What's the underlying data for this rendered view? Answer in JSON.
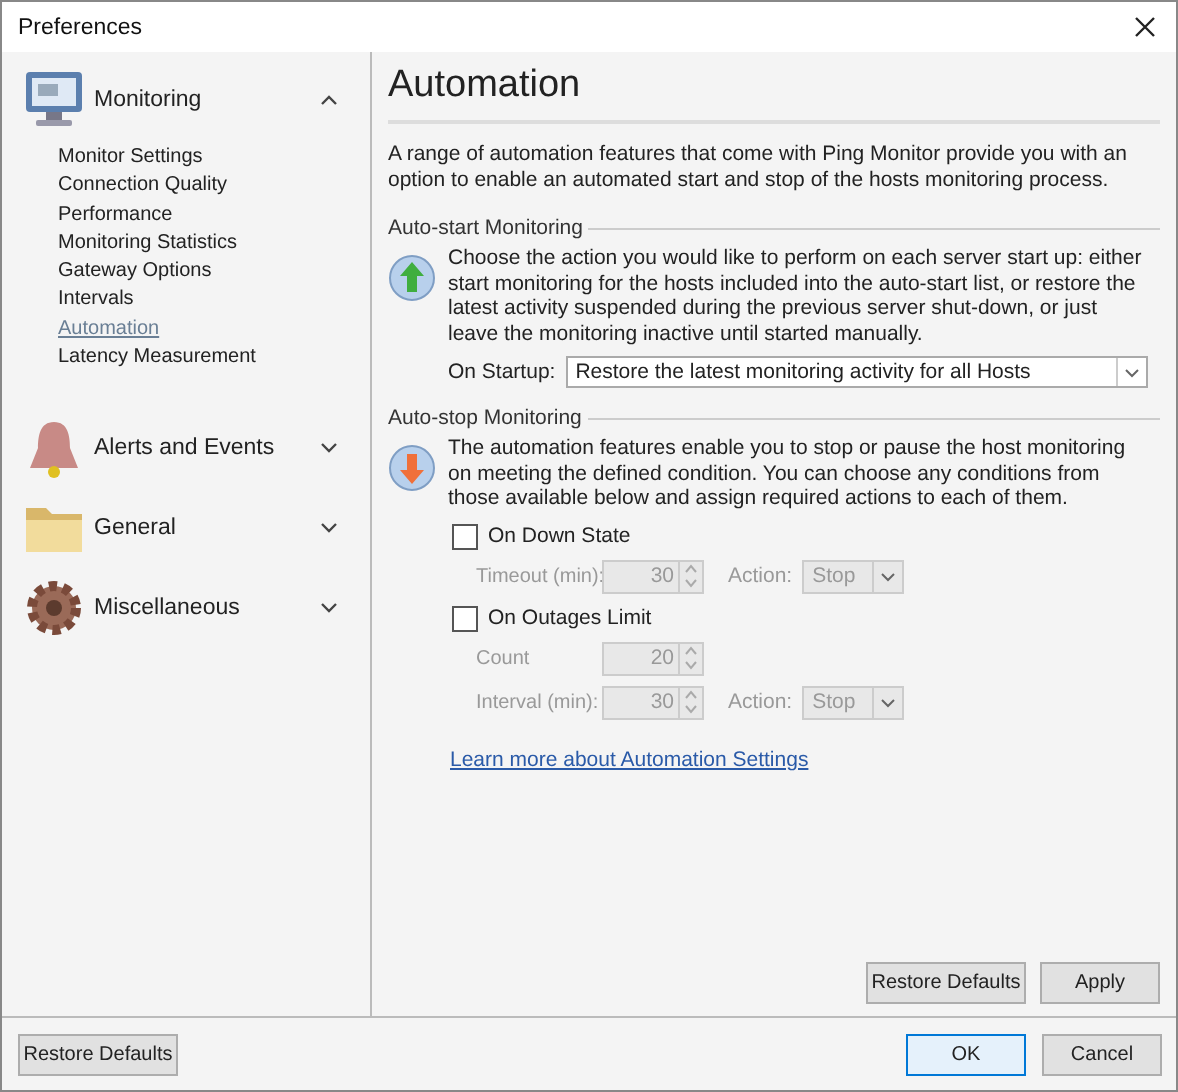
{
  "window": {
    "title": "Preferences"
  },
  "sidebar": {
    "groups": [
      {
        "kind": "monitor",
        "label": "Monitoring",
        "expanded": true,
        "items": [
          {
            "label": "Monitor Settings",
            "selected": false
          },
          {
            "label": "Connection Quality",
            "selected": false
          },
          {
            "label": "Performance",
            "selected": false
          },
          {
            "label": "Monitoring Statistics",
            "selected": false
          },
          {
            "label": "Gateway Options",
            "selected": false
          },
          {
            "label": "Intervals",
            "selected": false
          },
          {
            "label": "Automation",
            "selected": true
          },
          {
            "label": "Latency Measurement",
            "selected": false
          }
        ]
      },
      {
        "kind": "bell",
        "label": "Alerts and Events",
        "expanded": false
      },
      {
        "kind": "folder",
        "label": "General",
        "expanded": false
      },
      {
        "kind": "gear",
        "label": "Miscellaneous",
        "expanded": false
      }
    ]
  },
  "page": {
    "title": "Automation",
    "intro": "A range of automation features that come with Ping Monitor provide you with an option to enable an automated start and stop of the hosts monitoring process.",
    "sections": [
      {
        "kind": "start",
        "heading": "Auto-start Monitoring",
        "description": "Choose the action you would like to perform on each server start up: either start monitoring for the hosts included into the auto-start list, or restore the latest activity suspended during the previous server shut-down, or just leave the monitoring inactive until started manually.",
        "select": {
          "label": "On Startup:",
          "value": "Restore the latest monitoring activity for all Hosts"
        }
      },
      {
        "kind": "stop",
        "heading": "Auto-stop Monitoring",
        "description": "The automation features enable you to stop or pause the host monitoring on meeting the defined condition. You can choose any conditions from those available below and assign required actions to each of them.",
        "options": [
          {
            "label": "On Down State",
            "checked": false,
            "rows": [
              {
                "label": "Timeout (min):",
                "value": "30",
                "disabled": true,
                "action_label": "Action:",
                "action_value": "Stop"
              }
            ]
          },
          {
            "label": "On Outages Limit",
            "checked": false,
            "rows": [
              {
                "label": "Count",
                "value": "20",
                "disabled": true
              },
              {
                "label": "Interval (min):",
                "value": "30",
                "disabled": true,
                "action_label": "Action:",
                "action_value": "Stop"
              }
            ]
          }
        ]
      }
    ],
    "link": "Learn more about Automation Settings",
    "buttons": [
      "Restore Defaults",
      "Apply"
    ]
  },
  "footer": {
    "left_button": "Restore Defaults",
    "buttons": [
      {
        "label": "OK",
        "default": true
      },
      {
        "label": "Cancel",
        "default": false
      }
    ]
  }
}
